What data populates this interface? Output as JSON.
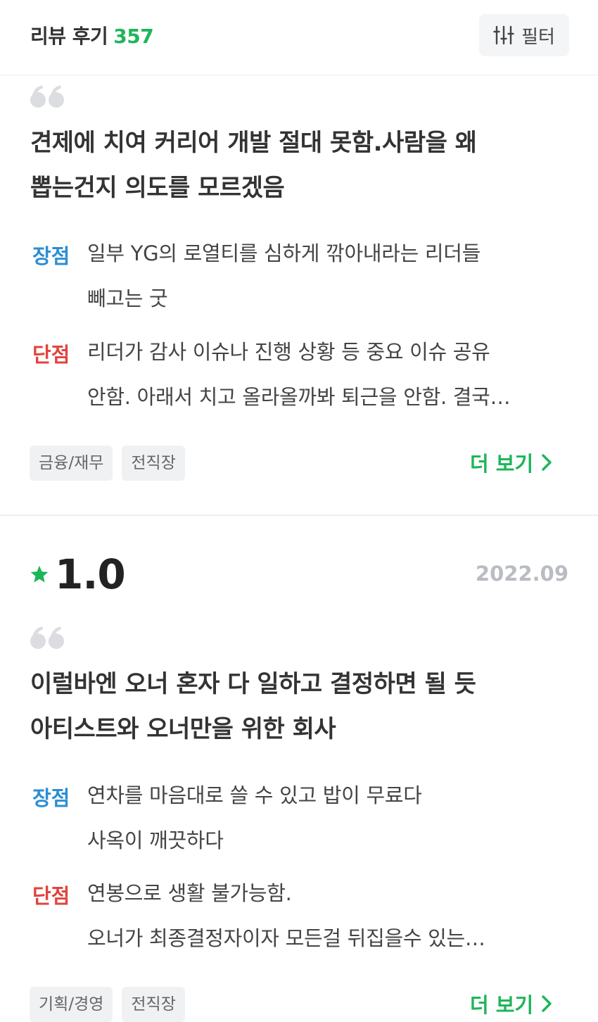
{
  "header": {
    "title": "리뷰 후기",
    "count": "357",
    "filter_label": "필터"
  },
  "reviews": [
    {
      "title_line1": "견제에 치여 커리어 개발 절대 못함.사람을 왜",
      "title_line2": "뽑는건지 의도를 모르겠음",
      "pros_label": "장점",
      "pros_line1": "일부 YG의 로열티를 심하게 깎아내라는 리더들",
      "pros_line2": "빼고는 굿",
      "cons_label": "단점",
      "cons_line1": "리더가 감사 이슈나 진행 상황 등 중요 이슈 공유",
      "cons_line2": "안함. 아래서 치고 올라올까봐 퇴근을 안함. 결국…",
      "tags": [
        "금융/재무",
        "전직장"
      ],
      "more_label": "더 보기"
    },
    {
      "rating": "1.0",
      "date": "2022.09",
      "title_line1": "이럴바엔 오너 혼자 다 일하고 결정하면 될 듯",
      "title_line2": "아티스트와 오너만을 위한 회사",
      "pros_label": "장점",
      "pros_line1": "연차를 마음대로 쓸 수 있고 밥이 무료다",
      "pros_line2": "사옥이 깨끗하다",
      "cons_label": "단점",
      "cons_line1": "연봉으로 생활 불가능함.",
      "cons_line2": "오너가 최종결정자이자 모든걸 뒤집을수 있는…",
      "tags": [
        "기획/경영",
        "전직장"
      ],
      "more_label": "더 보기"
    }
  ],
  "colors": {
    "accent_green": "#1eb55a",
    "pros_blue": "#2a8ed4",
    "cons_red": "#e0443d"
  }
}
